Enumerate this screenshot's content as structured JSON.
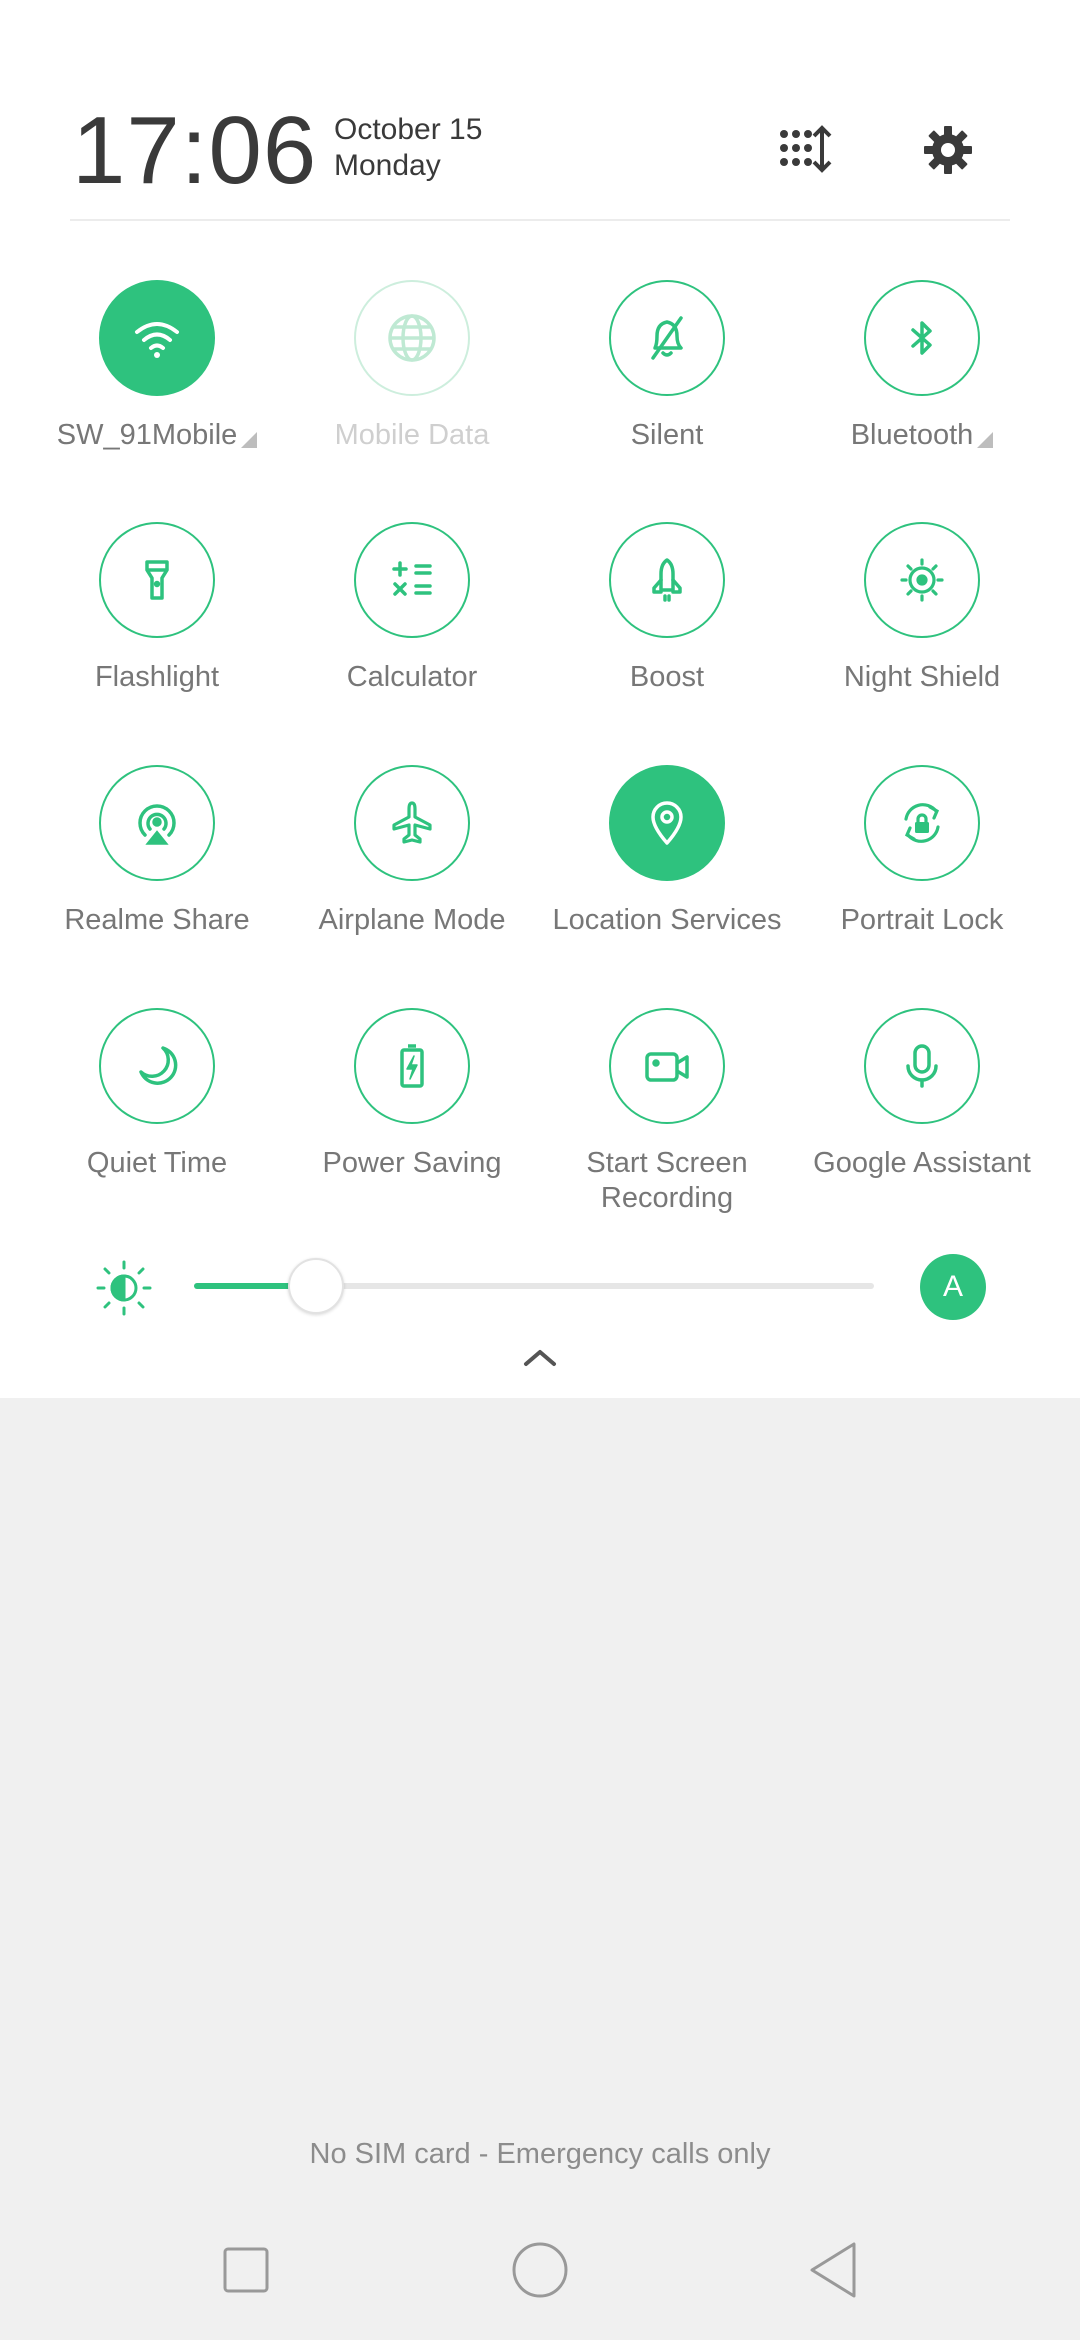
{
  "header": {
    "time": "17:06",
    "date": "October 15",
    "day": "Monday"
  },
  "tiles": [
    {
      "label": "SW_91Mobile",
      "icon": "wifi-icon",
      "state": "on"
    },
    {
      "label": "Mobile Data",
      "icon": "globe-icon",
      "state": "disabled"
    },
    {
      "label": "Silent",
      "icon": "bell-slash-icon",
      "state": "off"
    },
    {
      "label": "Bluetooth",
      "icon": "bluetooth-icon",
      "state": "off"
    },
    {
      "label": "Flashlight",
      "icon": "flashlight-icon",
      "state": "off"
    },
    {
      "label": "Calculator",
      "icon": "calculator-icon",
      "state": "off"
    },
    {
      "label": "Boost",
      "icon": "rocket-icon",
      "state": "off"
    },
    {
      "label": "Night Shield",
      "icon": "eye-sun-icon",
      "state": "off"
    },
    {
      "label": "Realme Share",
      "icon": "share-target-icon",
      "state": "off"
    },
    {
      "label": "Airplane Mode",
      "icon": "airplane-icon",
      "state": "off"
    },
    {
      "label": "Location Services",
      "icon": "location-pin-icon",
      "state": "on"
    },
    {
      "label": "Portrait Lock",
      "icon": "rotation-lock-icon",
      "state": "off"
    },
    {
      "label": "Quiet Time",
      "icon": "moon-icon",
      "state": "off"
    },
    {
      "label": "Power Saving",
      "icon": "battery-bolt-icon",
      "state": "off"
    },
    {
      "label": "Start Screen Recording",
      "icon": "video-camera-icon",
      "state": "off"
    },
    {
      "label": "Google Assistant",
      "icon": "microphone-icon",
      "state": "off"
    }
  ],
  "brightness": {
    "level": 0.18,
    "auto_label": "A"
  },
  "status": {
    "sim_text": "No SIM card - Emergency calls only"
  },
  "colors": {
    "accent": "#2ec27e",
    "panel": "#ffffff",
    "background": "#f0f0f0"
  }
}
